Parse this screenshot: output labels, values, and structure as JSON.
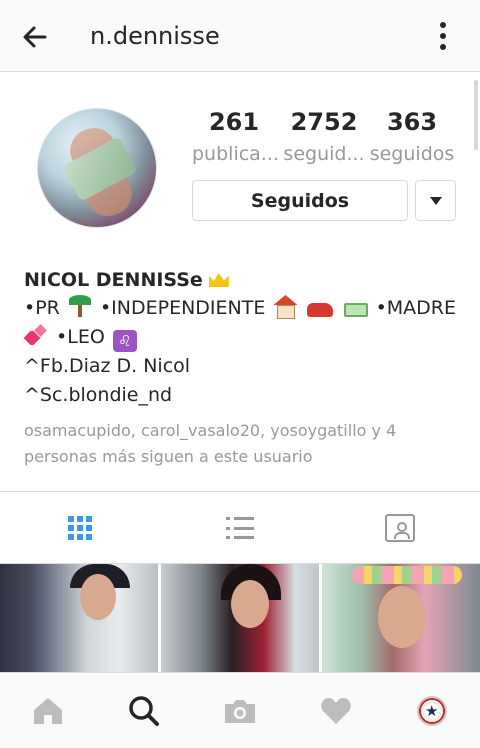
{
  "header": {
    "username": "n.dennisse",
    "back_icon": "arrow-left-icon",
    "more_icon": "more-vertical-icon"
  },
  "profile": {
    "stats": [
      {
        "value": "261",
        "label": "publica..."
      },
      {
        "value": "2752",
        "label": "seguid..."
      },
      {
        "value": "363",
        "label": "seguidos"
      }
    ],
    "follow_button": "Seguidos",
    "dropdown_icon": "chevron-down-icon"
  },
  "bio": {
    "name": "NICOL DENNISSe",
    "line1_a": "•PR",
    "line1_b": "•INDEPENDIENTE",
    "line1_c": "•MADRE",
    "line2": "•LEO",
    "line3": "^Fb.Diaz D. Nicol",
    "line4": "^Sc.blondie_nd",
    "leo_symbol": "♌",
    "followed_by": "osamacupido, carol_vasalo20, yosoygatillo y 4 personas más siguen a este usuario"
  },
  "colors": {
    "accent": "#3897f0",
    "text": "#262626",
    "muted": "#999999"
  }
}
